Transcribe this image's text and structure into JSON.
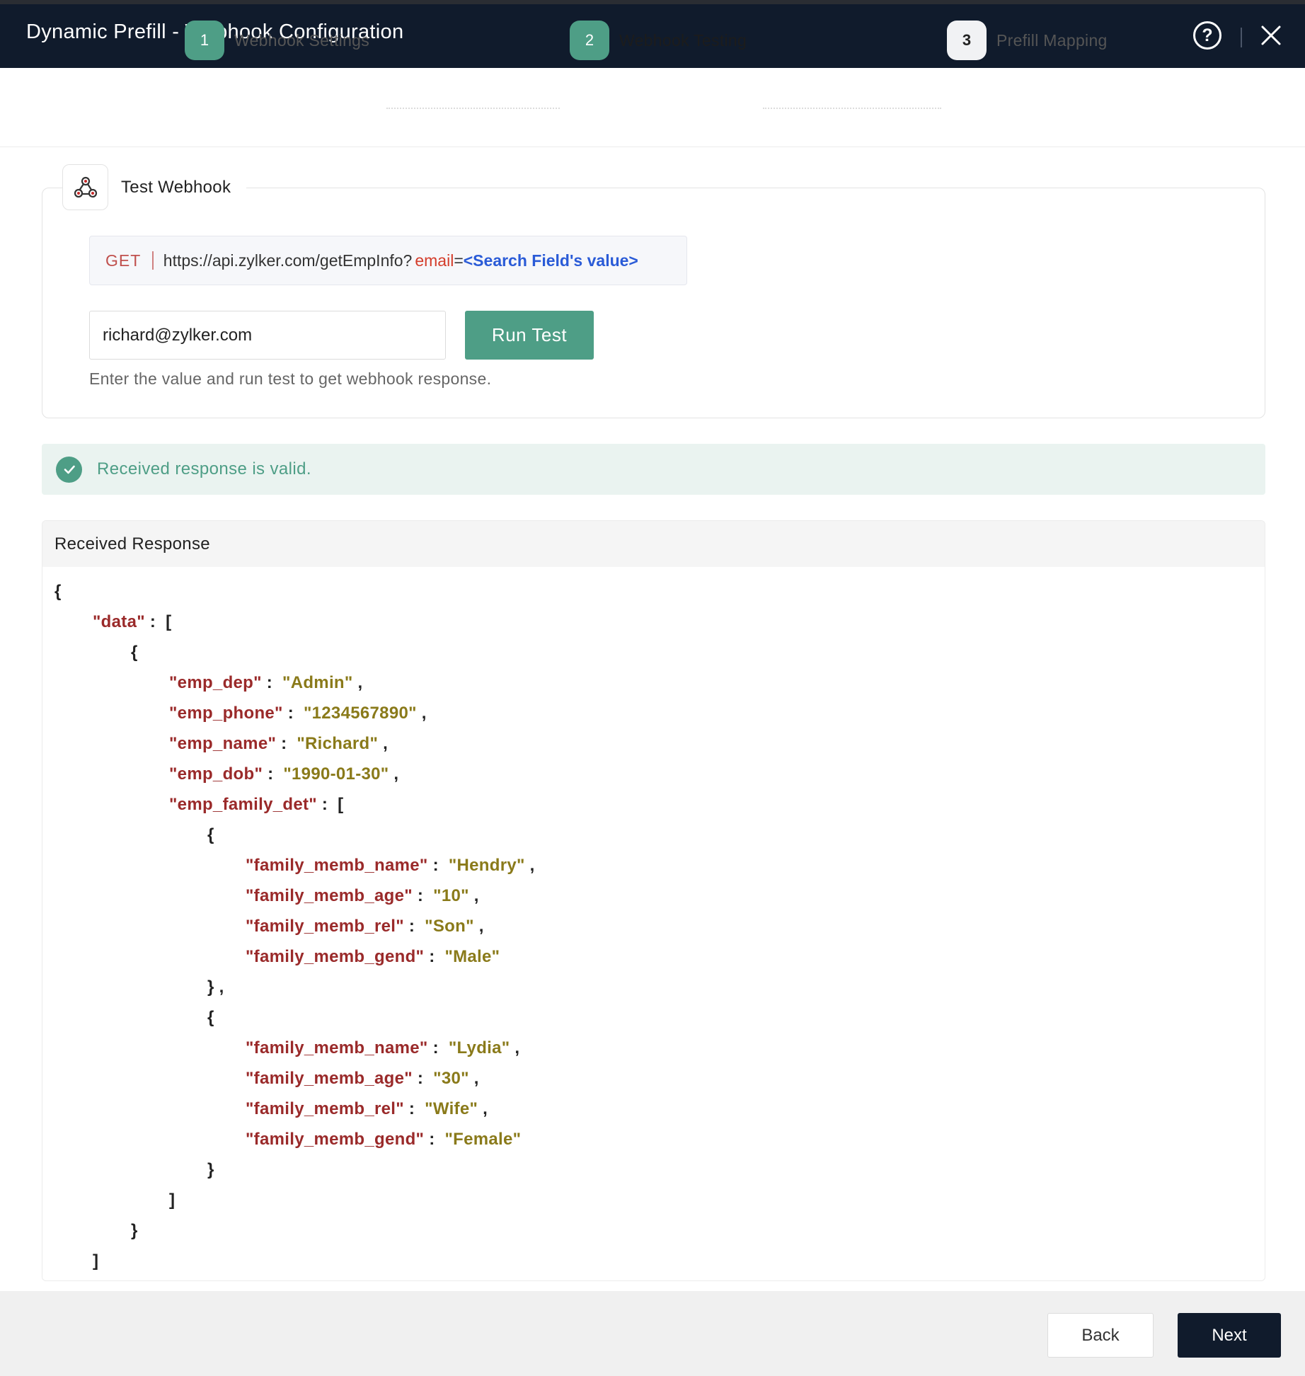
{
  "header": {
    "title": "Dynamic Prefill - Webhook Configuration",
    "help_icon": "question-circle-icon",
    "help_glyph": "?",
    "close_icon": "close-icon"
  },
  "stepper": {
    "steps": [
      {
        "number": "1",
        "label": "Webhook Settings",
        "state": "done"
      },
      {
        "number": "2",
        "label": "Webhook Testing",
        "state": "active"
      },
      {
        "number": "3",
        "label": "Prefill Mapping",
        "state": "pending"
      }
    ]
  },
  "test_webhook": {
    "icon": "webhook-icon",
    "title": "Test Webhook",
    "method": "GET",
    "url_base": "https://api.zylker.com/getEmpInfo?",
    "url_param": "email",
    "url_eq": "=",
    "url_placeholder": "<Search Field's value>",
    "input_value": "richard@zylker.com",
    "run_button": "Run Test",
    "hint": "Enter the value and run test to get webhook response."
  },
  "status": {
    "icon": "check-circle-icon",
    "message": "Received response is valid."
  },
  "response": {
    "title": "Received Response",
    "lines": [
      {
        "indent": 0,
        "parts": [
          {
            "t": "p",
            "s": "{"
          }
        ]
      },
      {
        "indent": 1,
        "parts": [
          {
            "t": "k",
            "s": "\"data\""
          },
          {
            "t": "p",
            "s": " :  ["
          }
        ]
      },
      {
        "indent": 2,
        "parts": [
          {
            "t": "p",
            "s": "{"
          }
        ]
      },
      {
        "indent": 3,
        "parts": [
          {
            "t": "k",
            "s": "\"emp_dep\""
          },
          {
            "t": "p",
            "s": " :  "
          },
          {
            "t": "v",
            "s": "\"Admin\""
          },
          {
            "t": "p",
            "s": " ,"
          }
        ]
      },
      {
        "indent": 3,
        "parts": [
          {
            "t": "k",
            "s": "\"emp_phone\""
          },
          {
            "t": "p",
            "s": " :  "
          },
          {
            "t": "v",
            "s": "\"1234567890\""
          },
          {
            "t": "p",
            "s": " ,"
          }
        ]
      },
      {
        "indent": 3,
        "parts": [
          {
            "t": "k",
            "s": "\"emp_name\""
          },
          {
            "t": "p",
            "s": " :  "
          },
          {
            "t": "v",
            "s": "\"Richard\""
          },
          {
            "t": "p",
            "s": " ,"
          }
        ]
      },
      {
        "indent": 3,
        "parts": [
          {
            "t": "k",
            "s": "\"emp_dob\""
          },
          {
            "t": "p",
            "s": " :  "
          },
          {
            "t": "v",
            "s": "\"1990-01-30\""
          },
          {
            "t": "p",
            "s": " ,"
          }
        ]
      },
      {
        "indent": 3,
        "parts": [
          {
            "t": "k",
            "s": "\"emp_family_det\""
          },
          {
            "t": "p",
            "s": " :  ["
          }
        ]
      },
      {
        "indent": 4,
        "parts": [
          {
            "t": "p",
            "s": "{"
          }
        ]
      },
      {
        "indent": 5,
        "parts": [
          {
            "t": "k",
            "s": "\"family_memb_name\""
          },
          {
            "t": "p",
            "s": " :  "
          },
          {
            "t": "v",
            "s": "\"Hendry\""
          },
          {
            "t": "p",
            "s": " ,"
          }
        ]
      },
      {
        "indent": 5,
        "parts": [
          {
            "t": "k",
            "s": "\"family_memb_age\""
          },
          {
            "t": "p",
            "s": " :  "
          },
          {
            "t": "v",
            "s": "\"10\""
          },
          {
            "t": "p",
            "s": " ,"
          }
        ]
      },
      {
        "indent": 5,
        "parts": [
          {
            "t": "k",
            "s": "\"family_memb_rel\""
          },
          {
            "t": "p",
            "s": " :  "
          },
          {
            "t": "v",
            "s": "\"Son\""
          },
          {
            "t": "p",
            "s": " ,"
          }
        ]
      },
      {
        "indent": 5,
        "parts": [
          {
            "t": "k",
            "s": "\"family_memb_gend\""
          },
          {
            "t": "p",
            "s": " :  "
          },
          {
            "t": "v",
            "s": "\"Male\""
          }
        ]
      },
      {
        "indent": 4,
        "parts": [
          {
            "t": "p",
            "s": "} ,"
          }
        ]
      },
      {
        "indent": 4,
        "parts": [
          {
            "t": "p",
            "s": "{"
          }
        ]
      },
      {
        "indent": 5,
        "parts": [
          {
            "t": "k",
            "s": "\"family_memb_name\""
          },
          {
            "t": "p",
            "s": " :  "
          },
          {
            "t": "v",
            "s": "\"Lydia\""
          },
          {
            "t": "p",
            "s": " ,"
          }
        ]
      },
      {
        "indent": 5,
        "parts": [
          {
            "t": "k",
            "s": "\"family_memb_age\""
          },
          {
            "t": "p",
            "s": " :  "
          },
          {
            "t": "v",
            "s": "\"30\""
          },
          {
            "t": "p",
            "s": " ,"
          }
        ]
      },
      {
        "indent": 5,
        "parts": [
          {
            "t": "k",
            "s": "\"family_memb_rel\""
          },
          {
            "t": "p",
            "s": " :  "
          },
          {
            "t": "v",
            "s": "\"Wife\""
          },
          {
            "t": "p",
            "s": " ,"
          }
        ]
      },
      {
        "indent": 5,
        "parts": [
          {
            "t": "k",
            "s": "\"family_memb_gend\""
          },
          {
            "t": "p",
            "s": " :  "
          },
          {
            "t": "v",
            "s": "\"Female\""
          }
        ]
      },
      {
        "indent": 4,
        "parts": [
          {
            "t": "p",
            "s": "}"
          }
        ]
      },
      {
        "indent": 3,
        "parts": [
          {
            "t": "p",
            "s": "]"
          }
        ]
      },
      {
        "indent": 2,
        "parts": [
          {
            "t": "p",
            "s": "}"
          }
        ]
      },
      {
        "indent": 1,
        "parts": [
          {
            "t": "p",
            "s": "]"
          }
        ]
      }
    ]
  },
  "footer": {
    "back_button": "Back",
    "next_button": "Next"
  },
  "colors": {
    "header_bg": "#101b2c",
    "accent": "#4e9e86",
    "json_key": "#9a2a2a",
    "json_value": "#8a7a1a",
    "url_param": "#d43c2a",
    "url_placeholder": "#2a5bd7"
  }
}
